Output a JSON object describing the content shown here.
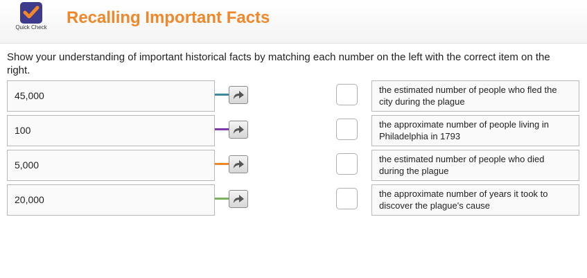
{
  "header": {
    "logo_text": "Quick Check",
    "title": "Recalling Important Facts"
  },
  "instructions": "Show your understanding of important historical facts by matching each number on the left with the correct item on the right.",
  "left_items": [
    {
      "label": "45,000",
      "connector_color": "#3d8a9e"
    },
    {
      "label": "100",
      "connector_color": "#7b3aa8"
    },
    {
      "label": "5,000",
      "connector_color": "#f0872a"
    },
    {
      "label": "20,000",
      "connector_color": "#7bb35a"
    }
  ],
  "right_items": [
    {
      "label": "the estimated number of people who fled the city during the plague"
    },
    {
      "label": "the approximate number of people living in Philadelphia in 1793"
    },
    {
      "label": "the estimated number of people who died during the plague"
    },
    {
      "label": "the approximate number of years it took to discover the plague's cause"
    }
  ],
  "icons": {
    "logo": "checkmark-icon",
    "arrow_button": "curved-arrow-right-icon"
  }
}
